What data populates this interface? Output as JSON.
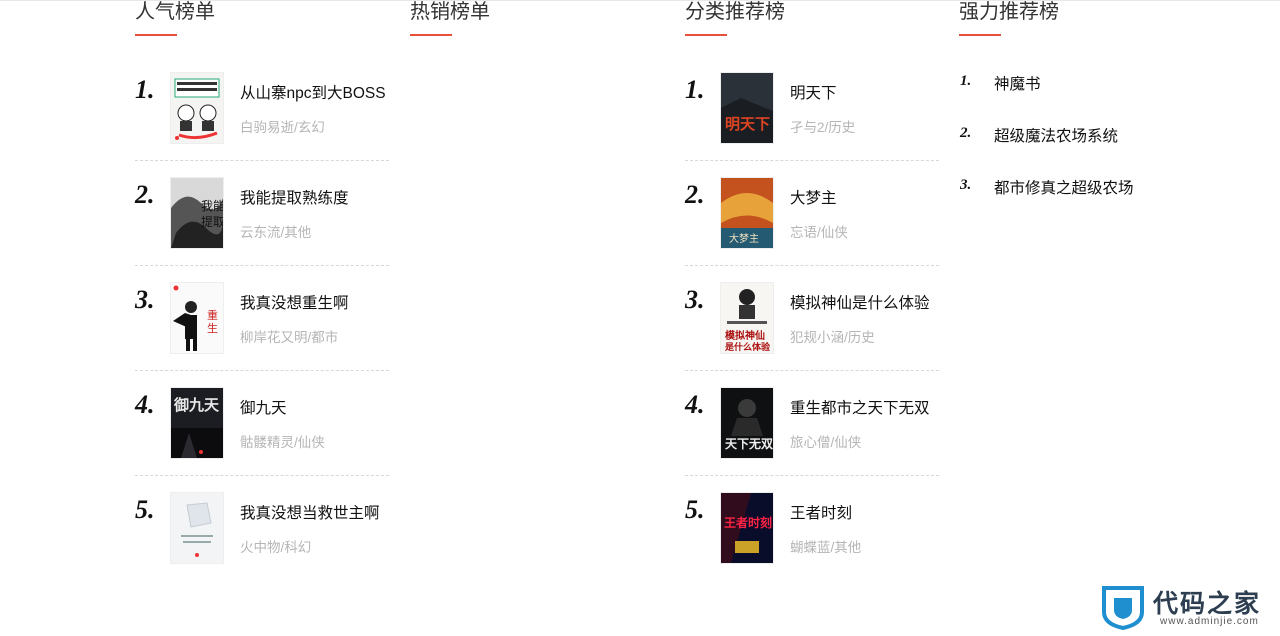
{
  "popular": {
    "title": "人气榜单",
    "items": [
      {
        "rank": "1.",
        "title": "从山寨npc到大BOSS",
        "meta": "白驹易逝/玄幻"
      },
      {
        "rank": "2.",
        "title": "我能提取熟练度",
        "meta": "云东流/其他"
      },
      {
        "rank": "3.",
        "title": "我真没想重生啊",
        "meta": "柳岸花又明/都市"
      },
      {
        "rank": "4.",
        "title": "御九天",
        "meta": "骷髅精灵/仙侠"
      },
      {
        "rank": "5.",
        "title": "我真没想当救世主啊",
        "meta": "火中物/科幻"
      }
    ]
  },
  "bestseller": {
    "title": "热销榜单"
  },
  "category": {
    "title": "分类推荐榜",
    "items": [
      {
        "rank": "1.",
        "title": "明天下",
        "meta": "孑与2/历史"
      },
      {
        "rank": "2.",
        "title": "大梦主",
        "meta": "忘语/仙侠"
      },
      {
        "rank": "3.",
        "title": "模拟神仙是什么体验",
        "meta": "犯规小涵/历史"
      },
      {
        "rank": "4.",
        "title": "重生都市之天下无双",
        "meta": "旅心僧/仙侠"
      },
      {
        "rank": "5.",
        "title": "王者时刻",
        "meta": "蝴蝶蓝/其他"
      }
    ]
  },
  "power": {
    "title": "强力推荐榜",
    "items": [
      {
        "rank": "1.",
        "title": "神魔书"
      },
      {
        "rank": "2.",
        "title": "超级魔法农场系统"
      },
      {
        "rank": "3.",
        "title": "都市修真之超级农场"
      }
    ]
  },
  "watermark": {
    "name": "代码之家",
    "url": "www.adminjie.com"
  },
  "colors": {
    "accent": "#e8503a",
    "meta_text": "#b5b5b5",
    "divider": "#d8d8d8"
  }
}
